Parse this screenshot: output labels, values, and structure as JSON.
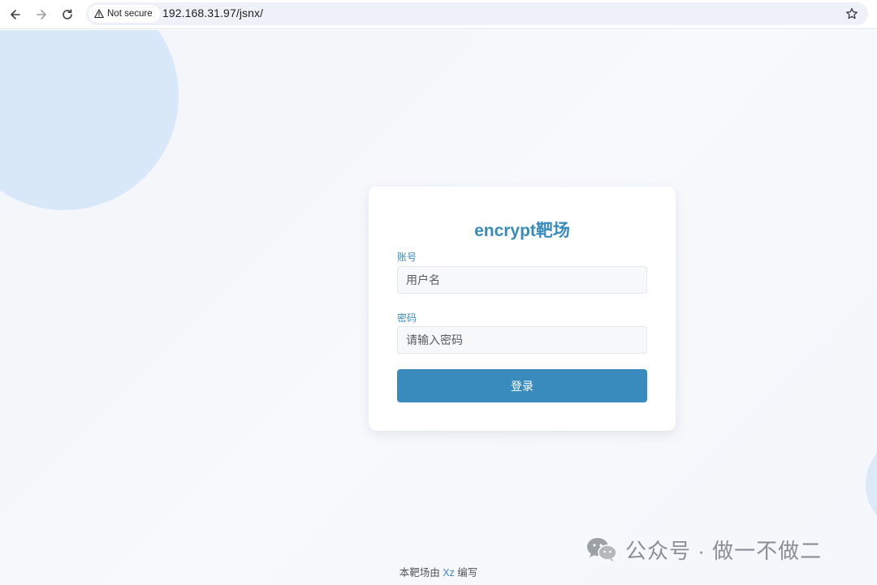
{
  "browser": {
    "security_label": "Not secure",
    "url": "192.168.31.97/jsnx/",
    "icons": [
      "back-icon",
      "forward-icon",
      "reload-icon",
      "warning-icon",
      "star-icon"
    ]
  },
  "login": {
    "title": "encrypt靶场",
    "username_label": "账号",
    "username_placeholder": "用户名",
    "username_value": "",
    "password_label": "密码",
    "password_placeholder": "请输入密码",
    "password_value": "",
    "submit_label": "登录"
  },
  "footer": {
    "prefix": "本靶场由",
    "author": "Xz",
    "suffix": "编写"
  },
  "watermark": {
    "text": "公众号 · 做一不做二"
  },
  "colors": {
    "accent": "#3a8bbd",
    "bubble": "#d9e8f9",
    "page_bg": "#f4f7fb"
  }
}
